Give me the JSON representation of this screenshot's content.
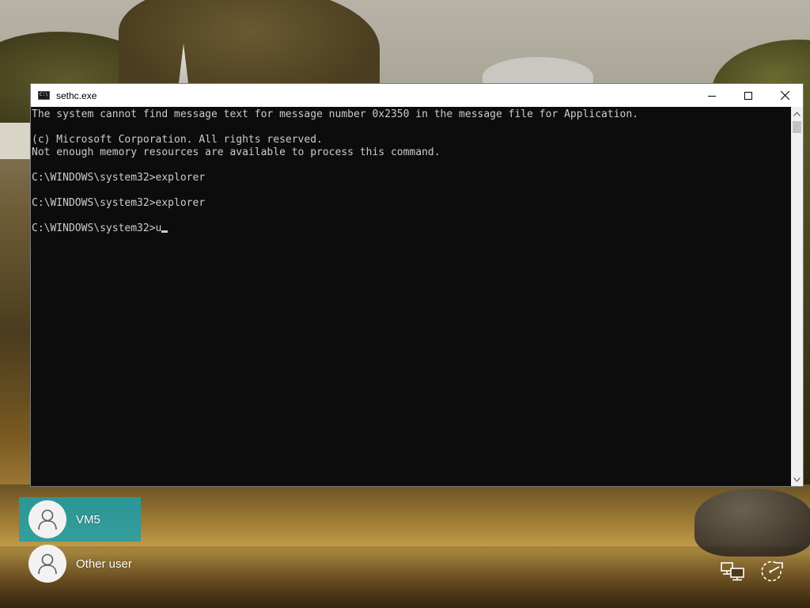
{
  "window": {
    "title": "sethc.exe",
    "icon": "console-icon",
    "icon_text": "C:\\"
  },
  "console": {
    "lines": [
      "The system cannot find message text for message number 0x2350 in the message file for Application.",
      "",
      "(c) Microsoft Corporation. All rights reserved.",
      "Not enough memory resources are available to process this command.",
      "",
      "C:\\WINDOWS\\system32>explorer",
      "",
      "C:\\WINDOWS\\system32>explorer",
      ""
    ],
    "prompt": "C:\\WINDOWS\\system32>",
    "current_input": "u"
  },
  "users": [
    {
      "name": "VM5",
      "selected": true
    },
    {
      "name": "Other user",
      "selected": false
    }
  ],
  "colors": {
    "console_bg": "#0c0c0c",
    "console_fg": "#cccccc",
    "selected_tile": "#1da0aa"
  },
  "icons": {
    "network": "network-icon",
    "power": "power-icon"
  }
}
